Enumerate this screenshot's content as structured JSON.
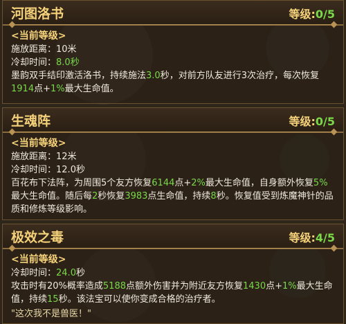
{
  "panels": [
    {
      "title": "河图洛书",
      "level_label": "等级:",
      "level_value": "0/5",
      "subheader": "<当前等级>",
      "range_label": "施放距离：",
      "range_value": "10米",
      "cooldown_label": "冷却时间：",
      "cooldown_value": "8.0秒",
      "desc": {
        "t1": "墨韵双手结印激活洛书，持续施法",
        "v1": "3.0",
        "t2": "秒，对前方队友进行3次治疗，每次恢复",
        "v2": "1914",
        "t3": "点+",
        "v3": "1%",
        "t4": "最大生命值。"
      }
    },
    {
      "title": "生魂阵",
      "level_label": "等级:",
      "level_value": "0/5",
      "subheader": "<当前等级>",
      "range_label": "施放距离：",
      "range_value": "12米",
      "cooldown_label": "冷却时间：",
      "cooldown_value": "12.0秒",
      "desc": {
        "t1": "百花布下法阵，为周围5个友方恢复",
        "v1": "6144",
        "t2": "点+",
        "v2": "2%",
        "t3": "最大生命值，自身额外恢复",
        "v3": "5%",
        "t4": "最大生命值。随后每",
        "v4": "2",
        "t5": "秒恢复",
        "v5": "3983",
        "t6": "点生命值，持续",
        "v6": "8",
        "t7": "秒。恢复值受到炼魔神针的品质和修炼等级影响。"
      }
    },
    {
      "title": "极效之毒",
      "level_label": "等级:",
      "level_value": "4/5",
      "subheader": "<当前等级>",
      "cooldown_label": "冷却时间：",
      "cooldown_value": "24.0",
      "cooldown_unit": "秒",
      "desc": {
        "t1": "攻击时有20%概率造成",
        "v1": "5188",
        "t2": "点额外伤害并为附近友方恢复",
        "v2": "1430",
        "t3": "点+",
        "v3": "1%",
        "t4": "最大生命值，持续",
        "v4": "15",
        "t5": "秒。该法宝可以使你变成合格的治疗者。"
      },
      "quote": "\"这次我不是兽医！\""
    }
  ]
}
